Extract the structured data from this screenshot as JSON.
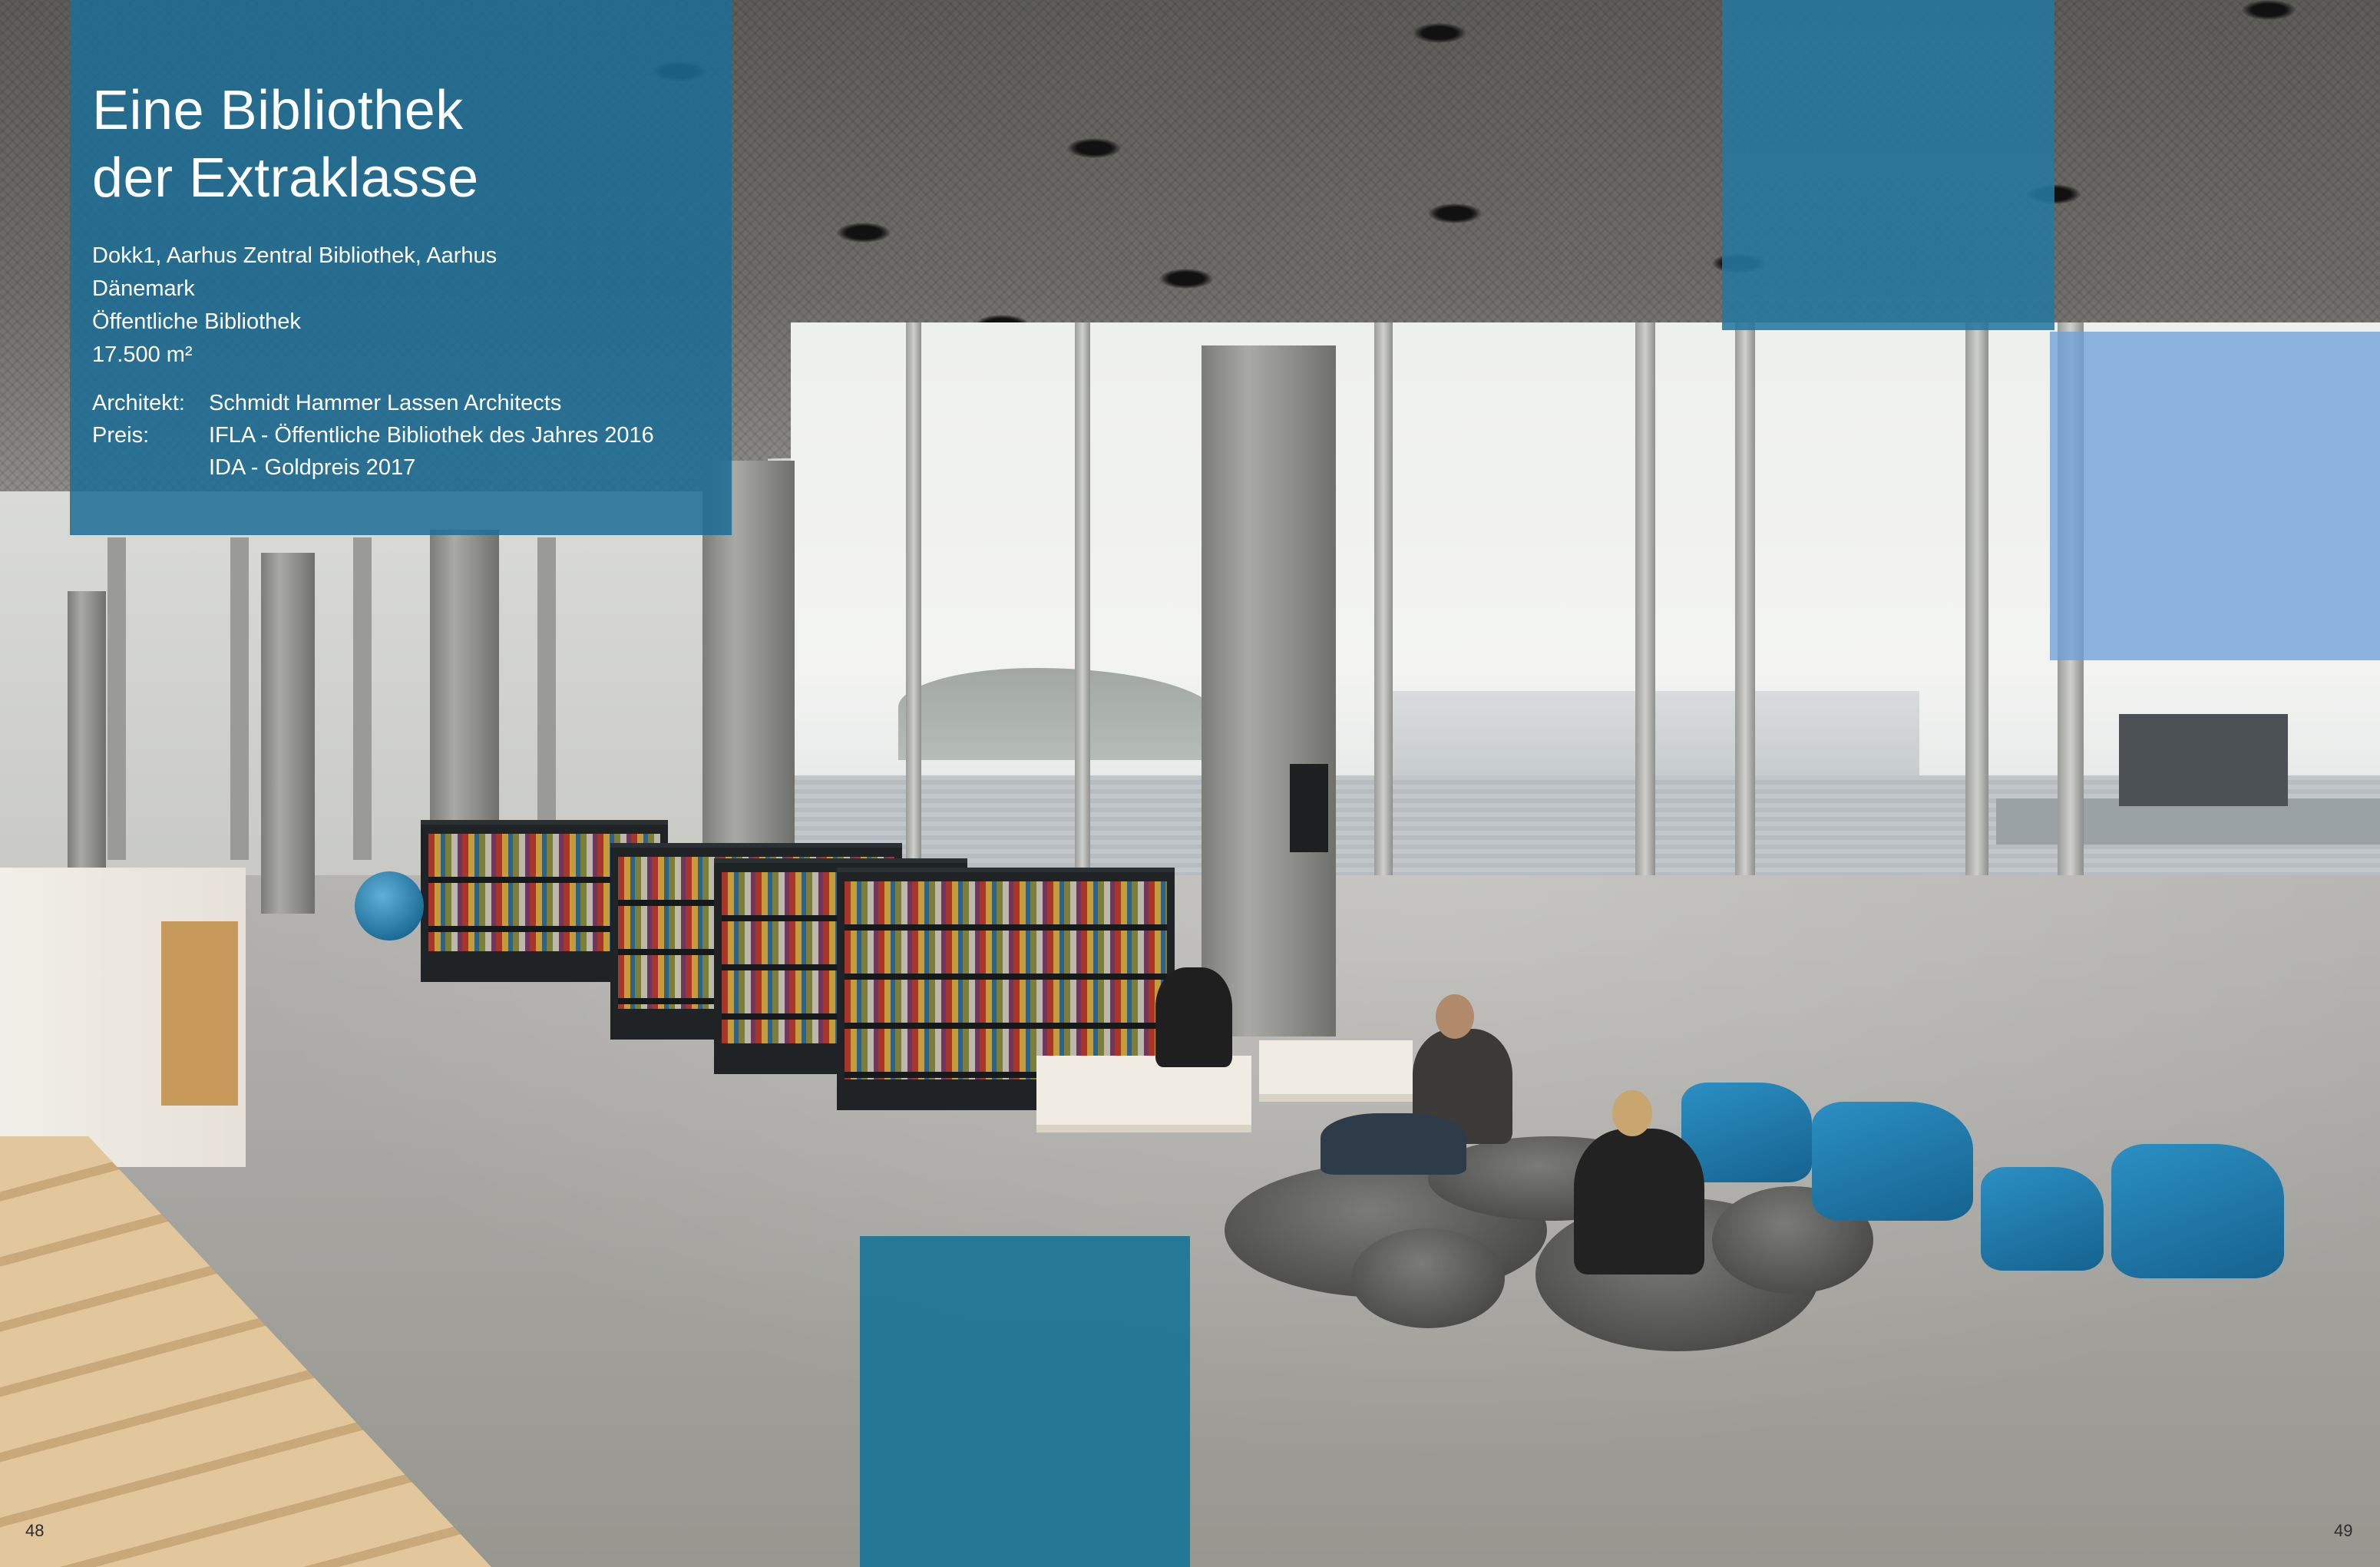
{
  "title": "Eine Bibliothek\nder Extraklasse",
  "details": {
    "location": "Dokk1, Aarhus Zentral Bibliothek, Aarhus",
    "country": "Dänemark",
    "type": "Öffentliche Bibliothek",
    "area": "17.500 m²"
  },
  "credits": {
    "architect_label": "Architekt:",
    "architect_value": "Schmidt Hammer Lassen Architects",
    "award_label": "Preis:",
    "award_value_1": "IFLA - Öffentliche Bibliothek des Jahres 2016",
    "award_value_2": "IDA - Goldpreis 2017"
  },
  "page_numbers": {
    "left": "48",
    "right": "49"
  },
  "colors": {
    "overlay_blue": "#1c6e96",
    "overlay_light_blue": "#6ea0d7"
  }
}
